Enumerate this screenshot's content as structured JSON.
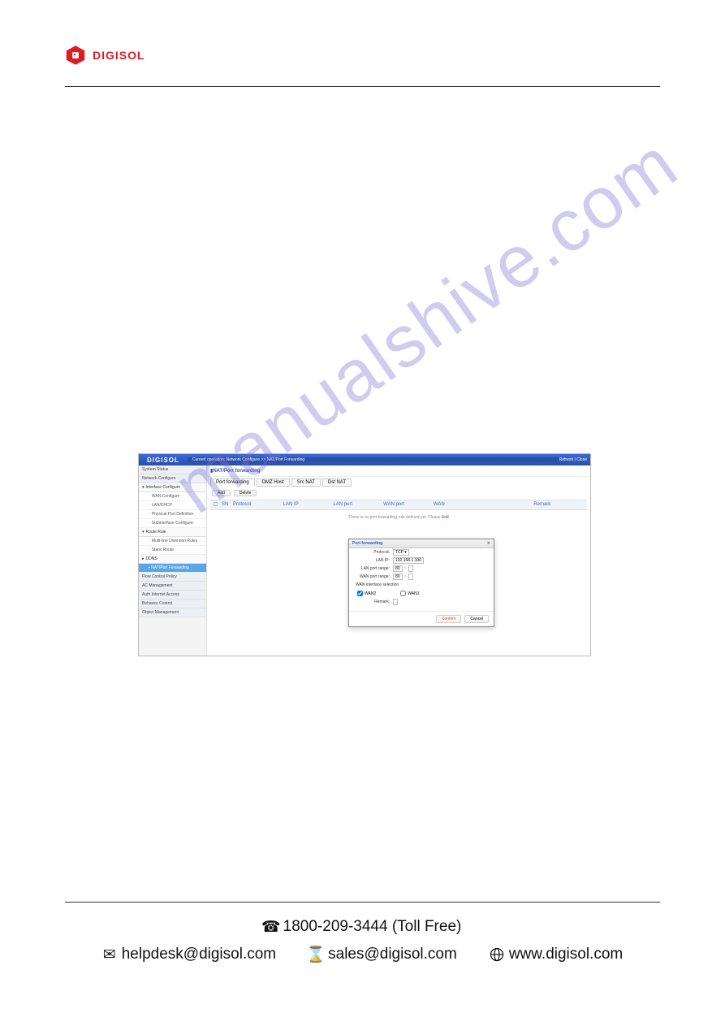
{
  "brand": "DIGISOL",
  "watermark": "manualshive.com",
  "app": {
    "brand": "DIGISOL",
    "breadcrumb": "Current operation: Network Configure >> NAT/Port Forwarding",
    "refresh": "Refresh | Close",
    "sidebar": {
      "system_status": "System Status",
      "network_configure": "Network Configure",
      "interface_configure": "Interface Configure",
      "wan_configure": "WAN Configure",
      "lan_dhcp": "LAN/DHCP",
      "physical_port_definition": "Physical Port Definition",
      "subinterface_configure": "Subinterface Configure",
      "route_rule": "Route Rule",
      "multiline_diversion": "Multi-line Diversion Rules",
      "static_route": "Static Route",
      "ddns": "DDNS",
      "nat_port_forwarding": "NAT/Port Forwarding",
      "flow_control_policy": "Flow Control Policy",
      "ac_management": "AC Management",
      "auth_internet_access": "Auth Internet Access",
      "behavior_control": "Behavior Control",
      "object_management": "Object Management"
    },
    "page_title": "NAT/Port forwarding",
    "tabs": {
      "port_forwarding": "Port forwarding",
      "dmz_host": "DMZ Host",
      "src_nat": "Src NAT",
      "dst_nat": "Dst NAT"
    },
    "toolbar": {
      "add": "Add",
      "delete": "Delete"
    },
    "columns": {
      "sn": "SN",
      "protocol": "Protocol",
      "lan_ip": "LAN IP",
      "lan_port": "LAN port",
      "wan_port": "WAN port",
      "wan": "WAN",
      "remark": "Remark"
    },
    "empty_prefix": "There is no port forwarding rule defined yet. Please ",
    "empty_link": "Add",
    "modal": {
      "title": "Port forwarding",
      "labels": {
        "protocol": "Protocol:",
        "lan_ip": "LAN IP:",
        "lan_port_range": "LAN port range:",
        "wan_port_range": "WAN port range:",
        "wan_if_sel": "WAN interface selection",
        "wan2": "WAN2",
        "wan1": "WAN1",
        "remark": "Remark:"
      },
      "values": {
        "protocol": "TCP",
        "lan_ip": "192.168.1.100",
        "lan_port_start": "80",
        "wan_port_start": "80",
        "wan2_checked": true,
        "wan1_checked": false
      },
      "confirm": "Confirm",
      "cancel": "Cancel"
    }
  },
  "footer": {
    "phone": "1800-209-3444 (Toll Free)",
    "helpdesk": "helpdesk@digisol.com",
    "sales": "sales@digisol.com",
    "web": "www.digisol.com"
  }
}
